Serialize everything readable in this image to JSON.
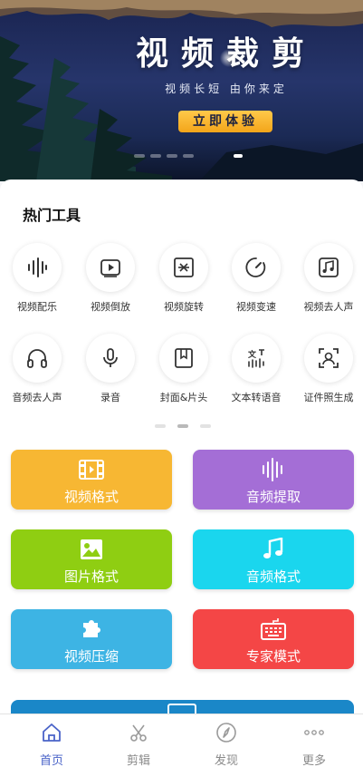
{
  "banner": {
    "title": "视频裁剪",
    "subtitle": "视频长短 由你来定",
    "cta_label": "立即体验",
    "slide_count": 5,
    "active_slide": 4
  },
  "hot_tools": {
    "title": "热门工具",
    "items": [
      {
        "label": "视频配乐",
        "icon": "waveform-icon"
      },
      {
        "label": "视频倒放",
        "icon": "video-play-icon"
      },
      {
        "label": "视频旋转",
        "icon": "rotate-icon"
      },
      {
        "label": "视频变速",
        "icon": "speedometer-icon"
      },
      {
        "label": "视频去人声",
        "icon": "music-note-icon"
      },
      {
        "label": "音频去人声",
        "icon": "headphones-icon"
      },
      {
        "label": "录音",
        "icon": "microphone-icon"
      },
      {
        "label": "封面&片头",
        "icon": "bookmark-icon"
      },
      {
        "label": "文本转语音",
        "icon": "text-to-speech-icon"
      },
      {
        "label": "证件照生成",
        "icon": "portrait-icon"
      }
    ],
    "page_count": 3,
    "active_page": 1
  },
  "feature_cards": [
    {
      "label": "视频格式",
      "icon": "film-icon",
      "color": "#f7b733"
    },
    {
      "label": "音频提取",
      "icon": "sound-bars-icon",
      "color": "#a46ed6"
    },
    {
      "label": "图片格式",
      "icon": "image-icon",
      "color": "#8fce12"
    },
    {
      "label": "音频格式",
      "icon": "music-note-icon",
      "color": "#1ad6ee"
    },
    {
      "label": "视频压缩",
      "icon": "puzzle-icon",
      "color": "#3db4e4"
    },
    {
      "label": "专家模式",
      "icon": "keyboard-icon",
      "color": "#f44646"
    }
  ],
  "bottom_nav": [
    {
      "label": "首页",
      "icon": "home-icon",
      "active": true
    },
    {
      "label": "剪辑",
      "icon": "scissors-icon",
      "active": false
    },
    {
      "label": "发现",
      "icon": "compass-icon",
      "active": false
    },
    {
      "label": "更多",
      "icon": "more-dots-icon",
      "active": false
    }
  ],
  "colors": {
    "accent": "#4a63c8",
    "cta": "#f7b52a",
    "banner_bg": "#1f2d5c"
  }
}
